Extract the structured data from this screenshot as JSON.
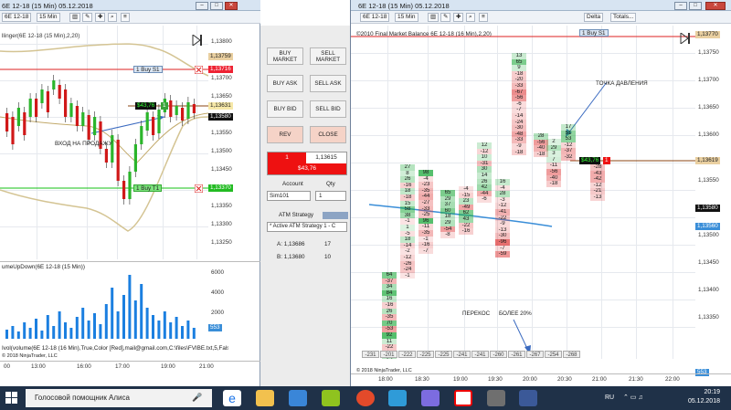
{
  "left_window": {
    "title": "6E 12-18 (15 Min)  05.12.2018",
    "toolbar": {
      "instrument": "6E 12-18",
      "interval": "15 Min"
    },
    "indicator_label": "llinger(6E 12-18 (15 Min),2,20)",
    "annotation": "ВХОД НА ПРОДАЖУ",
    "orders": {
      "buy_label": "1 Buy S1",
      "sell_label": "1 Buy T1",
      "position_pnl": "$43,76",
      "position_qty": "1"
    },
    "price_axis": [
      "1,13800",
      "1,13750",
      "1,13700",
      "1,13650",
      "1,13600",
      "1,13550",
      "1,13500",
      "1,13450",
      "1,13400",
      "1,13350",
      "1,13300",
      "1,13250"
    ],
    "price_tags": {
      "top": "1,13759",
      "sell": "1,13716",
      "last": "1,13631",
      "mid": "1,13580",
      "stop": "1,13370"
    },
    "volume_label": "umeUpDown(6E 12-18 (15 Min))",
    "volume_axis": [
      "6000",
      "4000",
      "2000"
    ],
    "volume_tag": "553",
    "footer_text": "Ivol(volume(6E 12-18 (16 Min),True,Color [Red],mail@gmail.com,C:\\files\\FVIBE.txt,5,False",
    "footer_copyright": "© 2018 NinjaTrader, LLC",
    "time_axis": [
      "00",
      "13:00",
      "16:00",
      "17:00",
      "19:00",
      "21:00"
    ]
  },
  "order_panel": {
    "buttons": [
      "BUY MARKET",
      "SELL MARKET",
      "BUY ASK",
      "SELL ASK",
      "BUY BID",
      "SELL BID",
      "REV",
      "CLOSE"
    ],
    "position_qty": "1",
    "position_price": "1,13615",
    "position_pnl": "$43,76",
    "account_label": "Account",
    "qty_label": "Qty",
    "account_value": "Sim101",
    "qty_value": "1",
    "atm_label": "ATM Strategy",
    "atm_value": "* Active ATM Strategy 1 - C",
    "row_a_label": "A: 1,13686",
    "row_a_value": "17",
    "row_b_label": "B: 1,13680",
    "row_b_value": "10"
  },
  "right_window": {
    "title": "6E 12-18 (15 Min)  05.12.2018",
    "toolbar": {
      "instrument": "6E 12-18",
      "interval": "15 Min",
      "delta": "Delta",
      "totals": "Totals..."
    },
    "indicator_label": "©2010 Final Market Balance  6E 12-18 (16 Min),2,20)",
    "annotation_top": "ТОЧКА ДАВЛЕНИЯ",
    "annotation_bottom_1": "ПЕРЕКОС",
    "annotation_bottom_2": "БОЛЕЕ 20%",
    "orders": {
      "buy_label": "1 Buy S1",
      "pnl": "$43,76",
      "qty": "1"
    },
    "price_axis": [
      "1,13750",
      "1,13700",
      "1,13650",
      "1,13600",
      "1,13550",
      "1,13500",
      "1,13450",
      "1,13400",
      "1,13350",
      "1,13300"
    ],
    "price_tags": {
      "top": "1,13770",
      "sell": "1,13716",
      "last": "1,13619",
      "low": "1,13580",
      "alt": "1,13560",
      "vol": "553"
    },
    "extra_axis": [
      "1,13750",
      "1,13700",
      "1,13650",
      "1,13600",
      "1,13550",
      "1,13500",
      "1,13450",
      "1,13400",
      "1,13350"
    ],
    "deltas": [
      "-231",
      "-201",
      "-222",
      "-225",
      "-225",
      "-241",
      "-241",
      "-260",
      "-261",
      "-267",
      "-254",
      "-268"
    ],
    "time_axis": [
      "18:00",
      "18:30",
      "19:00",
      "19:30",
      "20:00",
      "20:30",
      "21:00",
      "21:30",
      "22:00"
    ],
    "footer_copyright": "© 2018 NinjaTrader, LLC",
    "footprint": [
      {
        "col": 1,
        "cells": [
          "64",
          "-37",
          "34",
          "84",
          "16",
          "-16",
          "26",
          "-35",
          "70",
          "-53",
          "92",
          "11",
          "-22",
          "8",
          "25"
        ]
      },
      {
        "col": 2,
        "cells": [
          "27",
          "8",
          "26",
          "-16",
          "18",
          "-18",
          "15",
          "58",
          "38",
          "-1",
          "1",
          "-5",
          "18",
          "-14",
          "-2",
          "-12",
          "-26",
          "-24",
          "-1"
        ]
      },
      {
        "col": 3,
        "cells": [
          "98",
          "-4",
          "-23",
          "-35",
          "-44",
          "-27",
          "-33",
          "-25",
          "96",
          "-11",
          "-35",
          "-1",
          "-16",
          "-7"
        ]
      },
      {
        "col": 4,
        "cells": [
          "65",
          "29",
          "37",
          "60",
          "18",
          "29",
          "-54",
          "-8"
        ]
      },
      {
        "col": 5,
        "cells": [
          "-4",
          "-15",
          "23",
          "-49",
          "62",
          "43",
          "-22",
          "-16"
        ]
      },
      {
        "col": 6,
        "cells": [
          "12",
          "-12",
          "10",
          "-31",
          "30",
          "14",
          "26",
          "42",
          "-44",
          "-6"
        ]
      },
      {
        "col": 7,
        "cells": [
          "16",
          "-4",
          "28",
          "-3",
          "-12",
          "-41",
          "-22",
          "-9",
          "-13",
          "-30",
          "-96",
          "-7",
          "-59"
        ]
      },
      {
        "col": 8,
        "cells": [
          "13",
          "65",
          "9",
          "-18",
          "-20",
          "-33",
          "-67",
          "-56",
          "-6",
          "-7",
          "-14",
          "-24",
          "-30",
          "-48",
          "-33",
          "-9",
          "-18"
        ]
      },
      {
        "col": 9,
        "cells": [
          "28",
          "-56",
          "-40",
          "-18"
        ]
      },
      {
        "col": 10,
        "cells": [
          "2",
          "29",
          "3",
          "7",
          "-11",
          "-56",
          "-40",
          "-18"
        ]
      },
      {
        "col": 11,
        "cells": [
          "17",
          "51",
          "53",
          "-12",
          "-37",
          "-32"
        ]
      },
      {
        "col": 12,
        "cells": [
          "-28",
          "-43",
          "-42",
          "-12",
          "-21",
          "-13"
        ]
      }
    ]
  },
  "taskbar": {
    "search_text": "Голосовой помощник Алиса",
    "tray_lang": "RU",
    "time": "20:19",
    "date": "05.12.2018"
  }
}
